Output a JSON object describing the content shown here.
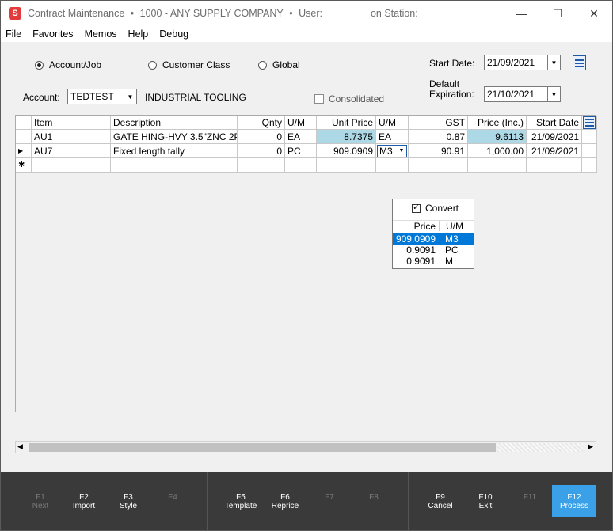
{
  "window": {
    "app_icon": "S",
    "title_parts": [
      "Contract Maintenance",
      "•",
      "1000 - ANY SUPPLY COMPANY",
      "•",
      "User:",
      "on Station:"
    ],
    "controls": [
      "minimize-icon",
      "maximize-icon",
      "close-icon"
    ]
  },
  "menu": [
    "File",
    "Favorites",
    "Memos",
    "Help",
    "Debug"
  ],
  "scope": {
    "options": [
      "Account/Job",
      "Customer Class",
      "Global"
    ],
    "selected": "Account/Job"
  },
  "account": {
    "label": "Account:",
    "value": "TEDTEST",
    "name": "INDUSTRIAL TOOLING"
  },
  "consolidated_label": "Consolidated",
  "dates": {
    "start_label": "Start Date:",
    "start_value": "21/09/2021",
    "expiration_label_1": "Default",
    "expiration_label_2": "Expiration:",
    "expiration_value": "21/10/2021"
  },
  "grid": {
    "columns": [
      "Item",
      "Description",
      "Qnty",
      "U/M",
      "Unit Price",
      "U/M",
      "GST",
      "Price (Inc.)",
      "Start Date"
    ],
    "rows": [
      {
        "item": "AU1",
        "description": "GATE HING-HVY 3.5\"ZNC 2P",
        "qnty": "0",
        "um": "EA",
        "unit_price": "8.7375",
        "um2": "EA",
        "gst": "0.87",
        "price_inc": "9.6113",
        "start_date": "21/09/2021"
      },
      {
        "item": "AU7",
        "description": "Fixed length tally",
        "qnty": "0",
        "um": "PC",
        "unit_price": "909.0909",
        "um2": "M3",
        "gst": "90.91",
        "price_inc": "1,000.00",
        "start_date": "21/09/2021"
      }
    ],
    "current_row_marker": "▶",
    "new_row_marker": "✱"
  },
  "um_popup": {
    "convert_label": "Convert",
    "convert_checked": true,
    "header": [
      "Price",
      "U/M"
    ],
    "options": [
      {
        "price": "909.0909",
        "um": "M3",
        "selected": true
      },
      {
        "price": "0.9091",
        "um": "PC",
        "selected": false
      },
      {
        "price": "0.9091",
        "um": "M",
        "selected": false
      }
    ]
  },
  "fkeys": [
    {
      "key": "F1",
      "label": "Next",
      "enabled": false
    },
    {
      "key": "F2",
      "label": "Import",
      "enabled": true
    },
    {
      "key": "F3",
      "label": "Style",
      "enabled": true
    },
    {
      "key": "F4",
      "label": "",
      "enabled": false
    },
    {
      "key": "F5",
      "label": "Template",
      "enabled": true
    },
    {
      "key": "F6",
      "label": "Reprice",
      "enabled": true
    },
    {
      "key": "F7",
      "label": "",
      "enabled": false
    },
    {
      "key": "F8",
      "label": "",
      "enabled": false
    },
    {
      "key": "F9",
      "label": "Cancel",
      "enabled": true
    },
    {
      "key": "F10",
      "label": "Exit",
      "enabled": true
    },
    {
      "key": "F11",
      "label": "",
      "enabled": false
    },
    {
      "key": "F12",
      "label": "Process",
      "enabled": true
    }
  ],
  "colors": {
    "selected_cell": "#add8e6",
    "highlight": "#0078d7",
    "primary_fkey": "#3aa0e8",
    "fkey_bar": "#3a3a3a",
    "app_icon": "#e23b3b"
  }
}
